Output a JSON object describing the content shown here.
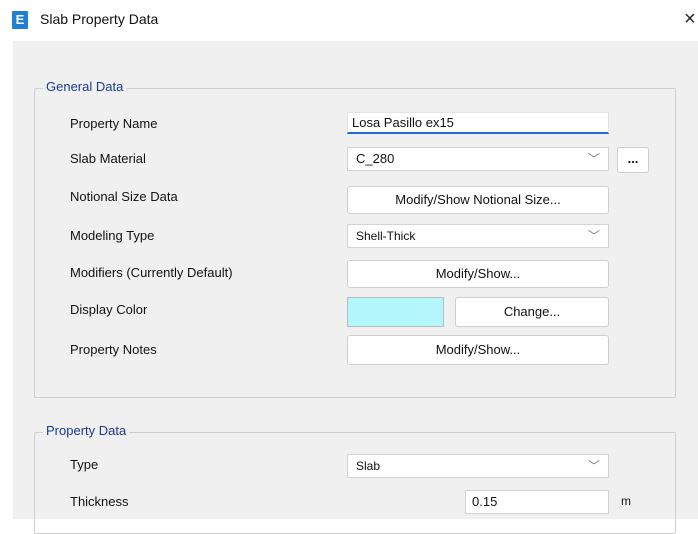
{
  "window": {
    "icon_letter": "E",
    "title": "Slab Property Data",
    "close_glyph": "×"
  },
  "general": {
    "legend": "General Data",
    "property_name_label": "Property Name",
    "property_name_value": "Losa Pasillo ex15",
    "slab_material_label": "Slab Material",
    "slab_material_value": "C_280",
    "slab_material_more": "...",
    "notional_label": "Notional Size Data",
    "notional_button": "Modify/Show Notional Size...",
    "modeling_type_label": "Modeling Type",
    "modeling_type_value": "Shell-Thick",
    "modifiers_label": "Modifiers (Currently Default)",
    "modifiers_button": "Modify/Show...",
    "display_color_label": "Display Color",
    "display_color_value": "#b3f7fd",
    "change_button": "Change...",
    "notes_label": "Property Notes",
    "notes_button": "Modify/Show..."
  },
  "property": {
    "legend": "Property Data",
    "type_label": "Type",
    "type_value": "Slab",
    "thickness_label": "Thickness",
    "thickness_value": "0.15",
    "thickness_unit": "m"
  }
}
